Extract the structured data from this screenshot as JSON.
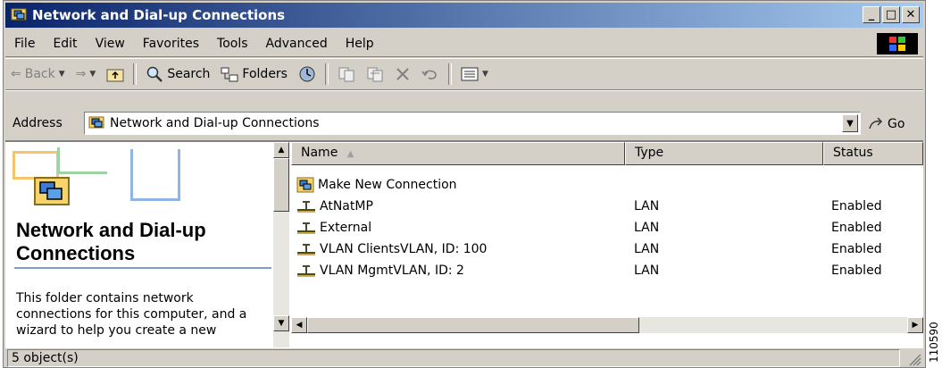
{
  "window": {
    "title": "Network and Dial-up Connections",
    "controls": {
      "minimize": "_",
      "maximize": "□",
      "close": "✕"
    }
  },
  "menu": [
    "File",
    "Edit",
    "View",
    "Favorites",
    "Tools",
    "Advanced",
    "Help"
  ],
  "toolbar": {
    "back": "Back",
    "search": "Search",
    "folders": "Folders"
  },
  "address": {
    "label": "Address",
    "value": "Network and Dial-up Connections",
    "go": "Go"
  },
  "left_panel": {
    "title": "Network and Dial-up Connections",
    "description": "This folder contains network connections for this computer, and a wizard to help you create a new"
  },
  "list": {
    "columns": {
      "name": "Name",
      "type": "Type",
      "status": "Status"
    },
    "sort_indicator": "▲",
    "rows": [
      {
        "name": "Make New Connection",
        "type": "",
        "status": "",
        "icon": "new-connection-icon"
      },
      {
        "name": "AtNatMP",
        "type": "LAN",
        "status": "Enabled",
        "icon": "lan-connection-icon"
      },
      {
        "name": "External",
        "type": "LAN",
        "status": "Enabled",
        "icon": "lan-connection-icon"
      },
      {
        "name": "VLAN ClientsVLAN, ID: 100",
        "type": "LAN",
        "status": "Enabled",
        "icon": "lan-connection-icon"
      },
      {
        "name": "VLAN MgmtVLAN, ID: 2",
        "type": "LAN",
        "status": "Enabled",
        "icon": "lan-connection-icon"
      }
    ]
  },
  "status_bar": {
    "text": "5 object(s)"
  },
  "figure_id": "110590",
  "colors": {
    "title_start": "#0a246a",
    "title_end": "#a6caf0",
    "chrome": "#d4d0c8"
  }
}
